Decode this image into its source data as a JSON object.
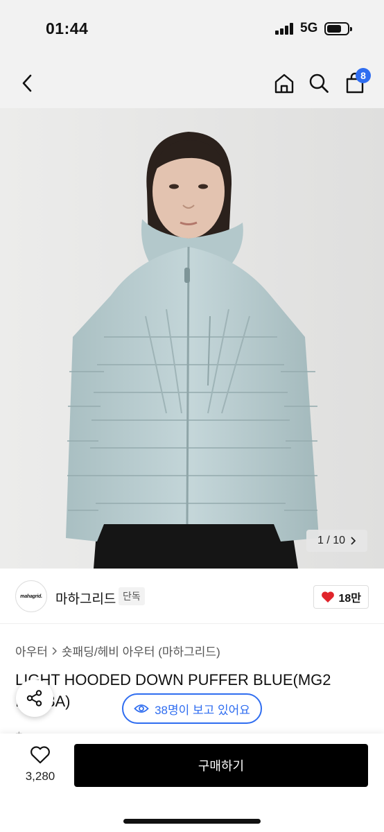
{
  "status_bar": {
    "time": "01:44",
    "network": "5G"
  },
  "nav": {
    "cart_count": "8"
  },
  "gallery": {
    "current": "1 / 10"
  },
  "brand": {
    "logo_text": "mahagrid.",
    "name": "마하그리드",
    "badge": "단독",
    "likes": "18만"
  },
  "product": {
    "category": "아우터",
    "subcategory": "숏패딩/헤비 아우터 (마하그리드)",
    "title": "LIGHT HOODED DOWN PUFFER BLUE(MG2 IB903A)"
  },
  "viewers": {
    "text": "38명이 보고 있어요"
  },
  "bottom": {
    "wish_count": "3,280",
    "buy_label": "구매하기"
  },
  "colors": {
    "accent": "#2f6df0",
    "like": "#e0242b",
    "jacket": "#b9cdd0"
  },
  "icons": [
    "back-icon",
    "home-icon",
    "search-icon",
    "bag-icon",
    "heart-icon",
    "chevron-right-icon",
    "share-icon",
    "eye-icon"
  ]
}
